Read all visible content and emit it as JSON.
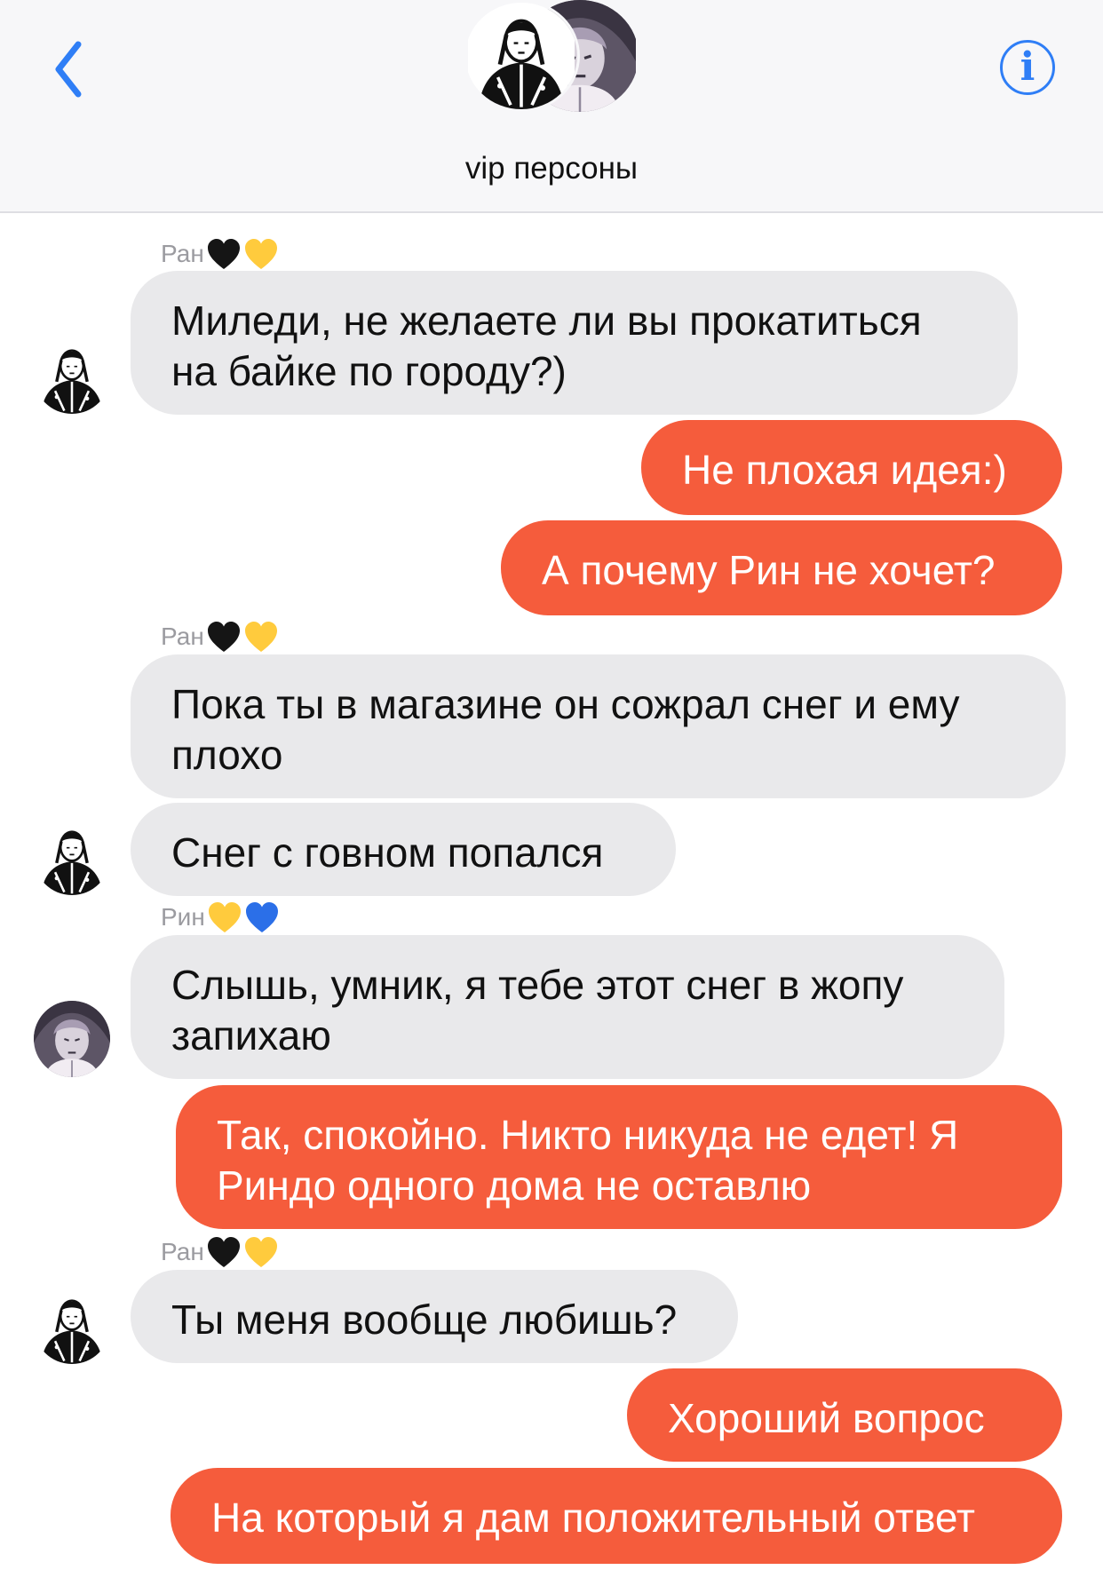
{
  "header": {
    "back_icon": "chevron-left-icon",
    "info_icon": "info-icon",
    "info_glyph": "i",
    "group_name": "vip персоны",
    "accent_color": "#2f7ef6"
  },
  "colors": {
    "incoming_bubble": "#e9e9eb",
    "outgoing_bubble": "#f55c3c",
    "sender_label": "#9b9ba0"
  },
  "messages": [
    {
      "sender": "Ран",
      "hearts": [
        "black",
        "yellow"
      ],
      "text": "Миледи, не желаете ли вы прокатиться\nна байке по городу?)"
    },
    {
      "text": "Не плохая идея:)"
    },
    {
      "text": "А почему Рин не хочет?"
    },
    {
      "sender": "Ран",
      "hearts": [
        "black",
        "yellow"
      ],
      "text": "Пока ты в магазине он сожрал снег и ему\nплохо"
    },
    {
      "text": "Снег с говном попался"
    },
    {
      "sender": "Рин",
      "hearts": [
        "yellow",
        "blue"
      ],
      "text": "Слышь, умник, я тебе этот снег в жопу\nзапихаю"
    },
    {
      "text": "Так, спокойно. Никто никуда не едет! Я\nРиндо одного дома не оставлю"
    },
    {
      "sender": "Ран",
      "hearts": [
        "black",
        "yellow"
      ],
      "text": "Ты меня вообще любишь?"
    },
    {
      "text": "Хороший вопрос"
    },
    {
      "text": "На который я дам положительный ответ"
    }
  ]
}
